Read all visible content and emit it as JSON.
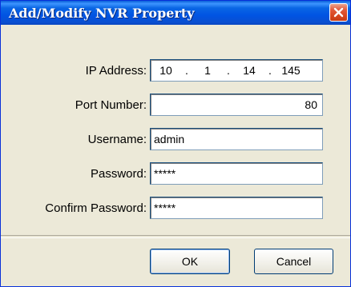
{
  "window": {
    "title": "Add/Modify NVR Property"
  },
  "form": {
    "ip_label": "IP Address:",
    "ip_octets": [
      "10",
      "1",
      "14",
      "145"
    ],
    "ip_separator": ".",
    "port_label": "Port Number:",
    "port_value": "80",
    "username_label": "Username:",
    "username_value": "admin",
    "password_label": "Password:",
    "password_value": "*****",
    "confirm_label": "Confirm Password:",
    "confirm_value": "*****"
  },
  "buttons": {
    "ok_label": "OK",
    "cancel_label": "Cancel"
  },
  "icons": {
    "close": "close-icon"
  },
  "colors": {
    "titlebar": "#0054e3",
    "close_button": "#d7461f",
    "dialog_background": "#ece9d8"
  }
}
